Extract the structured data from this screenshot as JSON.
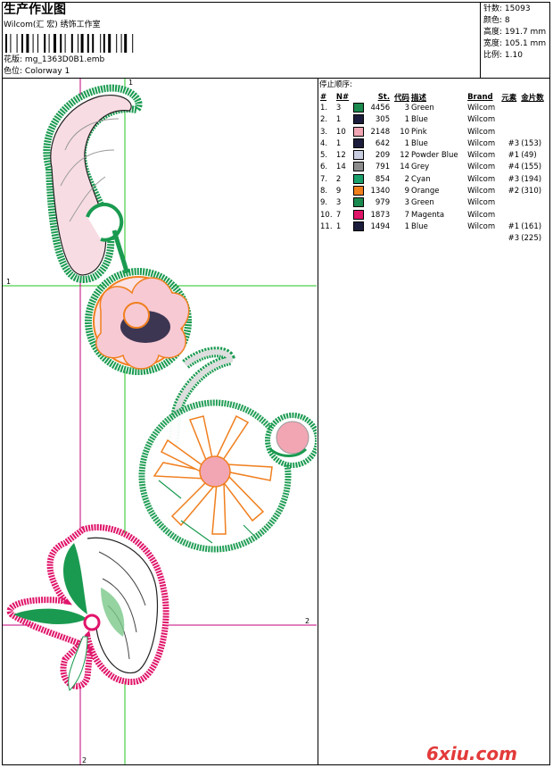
{
  "header": {
    "title": "生产作业图",
    "company": "Wilcom(汇 宏) 绣饰工作室",
    "design_label": "花版:",
    "design_value": "mg_1363D0B1.emb",
    "colorway_label": "色位:",
    "colorway_value": "Colorway 1"
  },
  "stats": [
    {
      "label": "针数:",
      "value": "15093"
    },
    {
      "label": "颜色:",
      "value": "8"
    },
    {
      "label": "高度:",
      "value": "191.7 mm"
    },
    {
      "label": "宽度:",
      "value": "105.1 mm"
    },
    {
      "label": "比例:",
      "value": "1.10"
    }
  ],
  "legend": {
    "title": "停止顺序:",
    "headers": [
      "#",
      "N#",
      "St.",
      "代码",
      "描述",
      "Brand",
      "元素",
      "金片数"
    ],
    "rows": [
      {
        "idx": "1.",
        "n": "3",
        "color": "#1a8a4e",
        "st": "4456",
        "code": "3",
        "desc": "Green",
        "brand": "Wilcom",
        "elem": "",
        "seq": ""
      },
      {
        "idx": "2.",
        "n": "1",
        "color": "#1c1c3c",
        "st": "305",
        "code": "1",
        "desc": "Blue",
        "brand": "Wilcom",
        "elem": "",
        "seq": ""
      },
      {
        "idx": "3.",
        "n": "10",
        "color": "#f2a6b4",
        "st": "2148",
        "code": "10",
        "desc": "Pink",
        "brand": "Wilcom",
        "elem": "",
        "seq": ""
      },
      {
        "idx": "4.",
        "n": "1",
        "color": "#1c1c3c",
        "st": "642",
        "code": "1",
        "desc": "Blue",
        "brand": "Wilcom",
        "elem": "#3",
        "seq": "(153)"
      },
      {
        "idx": "5.",
        "n": "12",
        "color": "#c9cde0",
        "st": "209",
        "code": "12",
        "desc": "Powder Blue",
        "brand": "Wilcom",
        "elem": "#1",
        "seq": "(49)"
      },
      {
        "idx": "6.",
        "n": "14",
        "color": "#8c8c8c",
        "st": "791",
        "code": "14",
        "desc": "Grey",
        "brand": "Wilcom",
        "elem": "#4",
        "seq": "(155)"
      },
      {
        "idx": "7.",
        "n": "2",
        "color": "#1aa06a",
        "st": "854",
        "code": "2",
        "desc": "Cyan",
        "brand": "Wilcom",
        "elem": "#3",
        "seq": "(194)"
      },
      {
        "idx": "8.",
        "n": "9",
        "color": "#f07f1e",
        "st": "1340",
        "code": "9",
        "desc": "Orange",
        "brand": "Wilcom",
        "elem": "#2",
        "seq": "(310)"
      },
      {
        "idx": "9.",
        "n": "3",
        "color": "#1a8a4e",
        "st": "979",
        "code": "3",
        "desc": "Green",
        "brand": "Wilcom",
        "elem": "",
        "seq": ""
      },
      {
        "idx": "10.",
        "n": "7",
        "color": "#e0156a",
        "st": "1873",
        "code": "7",
        "desc": "Magenta",
        "brand": "Wilcom",
        "elem": "",
        "seq": ""
      },
      {
        "idx": "11.",
        "n": "1",
        "color": "#1c1c3c",
        "st": "1494",
        "code": "1",
        "desc": "Blue",
        "brand": "Wilcom",
        "elem": "#1",
        "seq": "(161)"
      }
    ],
    "extra_elem": "#3",
    "extra_seq": "(225)"
  },
  "guides": {
    "label_1": "1",
    "label_2": "2"
  },
  "watermark": "6xiu.com",
  "colors": {
    "green": "#1a9a50",
    "magenta": "#e0156a",
    "pink": "#f2a6b4",
    "orange": "#f07f1e",
    "guide_green": "#22c422",
    "guide_magenta": "#c0007a"
  }
}
